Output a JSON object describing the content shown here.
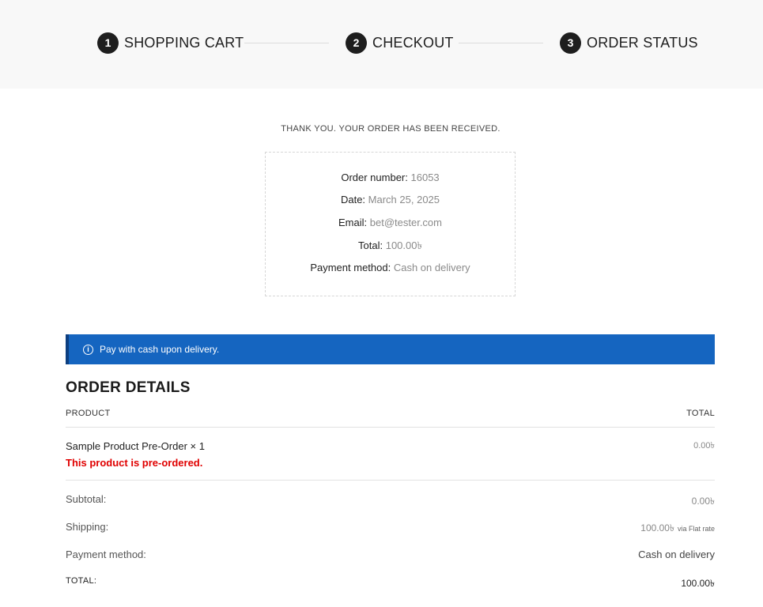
{
  "steps": [
    {
      "num": "1",
      "label": "SHOPPING CART"
    },
    {
      "num": "2",
      "label": "CHECKOUT"
    },
    {
      "num": "3",
      "label": "ORDER STATUS"
    }
  ],
  "thank_you": "THANK YOU. YOUR ORDER HAS BEEN RECEIVED.",
  "overview": {
    "order_number_label": "Order number:",
    "order_number": "16053",
    "date_label": "Date:",
    "date": "March 25, 2025",
    "email_label": "Email:",
    "email": "bet@tester.com",
    "total_label": "Total:",
    "total": "100.00৳",
    "payment_label": "Payment method:",
    "payment": "Cash on delivery"
  },
  "notice": {
    "icon": "info-icon",
    "text": "Pay with cash upon delivery.",
    "color": "#1565c0"
  },
  "order_details": {
    "title": "ORDER DETAILS",
    "col_product": "PRODUCT",
    "col_total": "TOTAL",
    "item": {
      "name": "Sample Product Pre-Order × 1",
      "note": "This product is pre-ordered.",
      "total": "0.00৳"
    },
    "subtotal_label": "Subtotal:",
    "subtotal": "0.00৳",
    "shipping_label": "Shipping:",
    "shipping": "100.00৳",
    "shipping_via": "via Flat rate",
    "payment_label": "Payment method:",
    "payment": "Cash on delivery",
    "total_label": "TOTAL:",
    "total": "100.00৳"
  }
}
